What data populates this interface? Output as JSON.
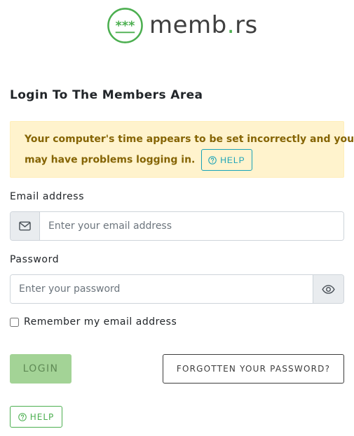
{
  "brand": {
    "logo_mark_text": "***",
    "name_prefix": "memb",
    "name_dot": ".",
    "name_suffix": "rs",
    "accent_color": "#4caf50"
  },
  "page_title": "Login To The Members Area",
  "warning": {
    "line1": "Your computer's time appears to be set incorrectly and you",
    "line2": "may have problems logging in.",
    "help_label": "HELP",
    "help_icon": "question-circle-icon"
  },
  "email": {
    "label": "Email address",
    "placeholder": "Enter your email address",
    "value": "",
    "icon": "envelope-icon"
  },
  "password": {
    "label": "Password",
    "placeholder": "Enter your password",
    "value": "",
    "icon": "eye-icon"
  },
  "remember": {
    "label": "Remember my email address",
    "checked": false
  },
  "buttons": {
    "login_label": "LOGIN",
    "forgot_label": "FORGOTTEN YOUR PASSWORD?",
    "help_label": "HELP"
  },
  "colors": {
    "warning_bg": "#fff3cd",
    "warning_text": "#856404",
    "info": "#17a2b8",
    "login_disabled_bg": "#a3d396"
  }
}
